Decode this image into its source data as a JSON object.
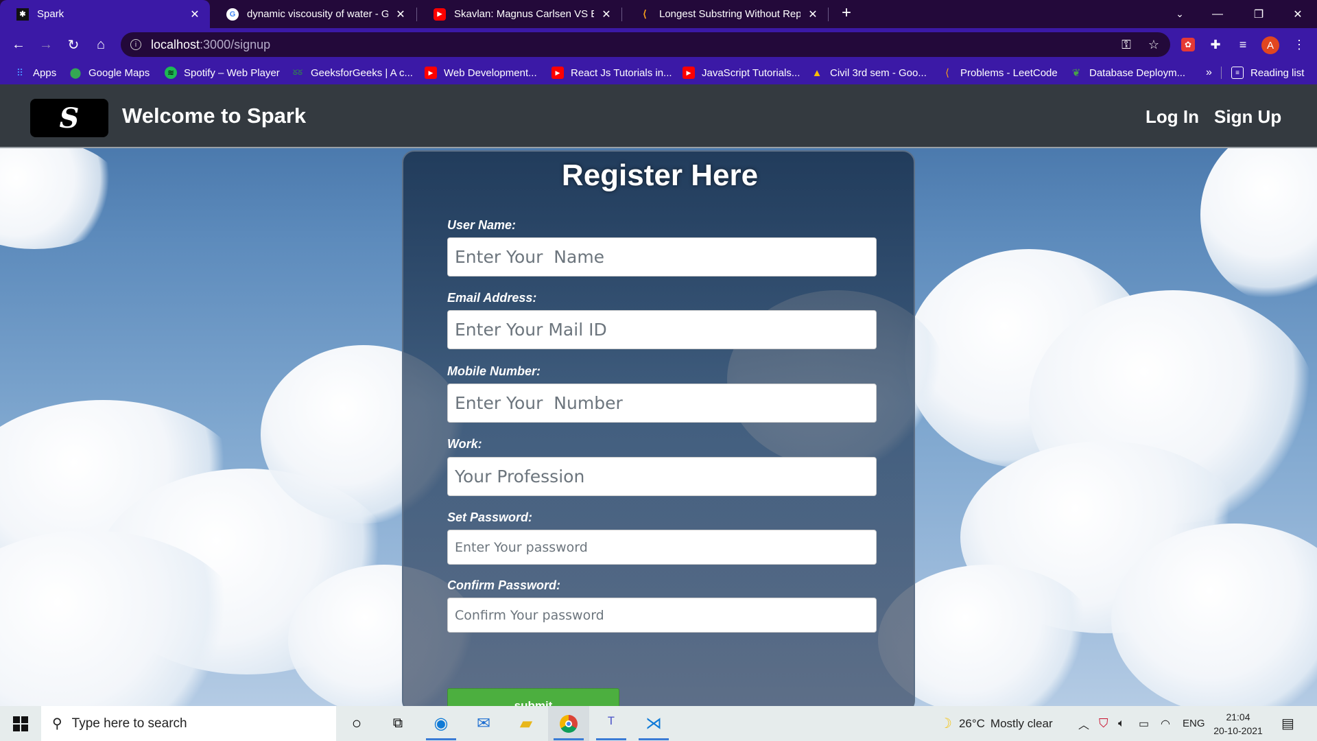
{
  "browser": {
    "tabs": [
      {
        "title": "Spark",
        "active": true
      },
      {
        "title": "dynamic viscousity of water - Go",
        "active": false
      },
      {
        "title": "Skavlan: Magnus Carlsen VS Bill C",
        "active": false
      },
      {
        "title": "Longest Substring Without Repe",
        "active": false
      }
    ],
    "new_tab": "+",
    "url_host": "localhost",
    "url_path": ":3000/signup",
    "profile_initial": "A",
    "bookmarks": [
      {
        "label": "Apps"
      },
      {
        "label": "Google Maps"
      },
      {
        "label": "Spotify – Web Player"
      },
      {
        "label": "GeeksforGeeks | A c..."
      },
      {
        "label": "Web Development..."
      },
      {
        "label": "React Js Tutorials in..."
      },
      {
        "label": "JavaScript Tutorials..."
      },
      {
        "label": "Civil 3rd sem - Goo..."
      },
      {
        "label": "Problems - LeetCode"
      },
      {
        "label": "Database Deploym..."
      }
    ],
    "bookmarks_overflow": "»",
    "reading_list": "Reading list"
  },
  "navbar": {
    "logo_glyph": "S",
    "brand": "Welcome to Spark",
    "login": "Log In",
    "signup": "Sign Up"
  },
  "form": {
    "title": "Register Here",
    "fields": [
      {
        "label": "User Name:",
        "placeholder": "Enter Your  Name"
      },
      {
        "label": "Email Address:",
        "placeholder": "Enter Your Mail ID"
      },
      {
        "label": "Mobile Number:",
        "placeholder": "Enter Your  Number"
      },
      {
        "label": "Work:",
        "placeholder": "Your Profession"
      },
      {
        "label": "Set Password:",
        "placeholder": "Enter Your password"
      },
      {
        "label": "Confirm Password:",
        "placeholder": "Confirm Your password"
      }
    ],
    "submit": "submit"
  },
  "taskbar": {
    "search_placeholder": "Type here to search",
    "weather_temp": "26°C",
    "weather_text": "Mostly clear",
    "language": "ENG",
    "time": "21:04",
    "date": "20-10-2021"
  },
  "colors": {
    "browser_frame": "#3b19a6",
    "navbar": "#343a40",
    "submit": "#4caf3f"
  }
}
